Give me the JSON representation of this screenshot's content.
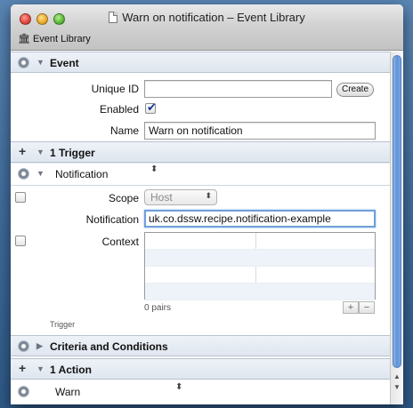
{
  "window": {
    "title": "Warn on notification – Event Library",
    "breadcrumb": "Event Library"
  },
  "event": {
    "header": "Event",
    "unique_id_label": "Unique ID",
    "unique_id_value": "",
    "create_label": "Create",
    "enabled_label": "Enabled",
    "enabled_checked": true,
    "name_label": "Name",
    "name_value": "Warn on notification"
  },
  "trigger": {
    "header": "1 Trigger",
    "type": "Notification",
    "scope_label": "Scope",
    "scope_value": "Host",
    "notification_label": "Notification",
    "notification_value": "uk.co.dssw.recipe.notification-example",
    "context_label": "Context",
    "pairs_label": "0 pairs",
    "footer_label": "Trigger",
    "add_symbol": "+",
    "remove_symbol": "−"
  },
  "criteria": {
    "header": "Criteria and Conditions"
  },
  "action": {
    "header": "1 Action",
    "type": "Warn"
  },
  "icons": {
    "plus": "+",
    "tri_down": "▼",
    "tri_right": "▶",
    "updown": "⬍"
  }
}
